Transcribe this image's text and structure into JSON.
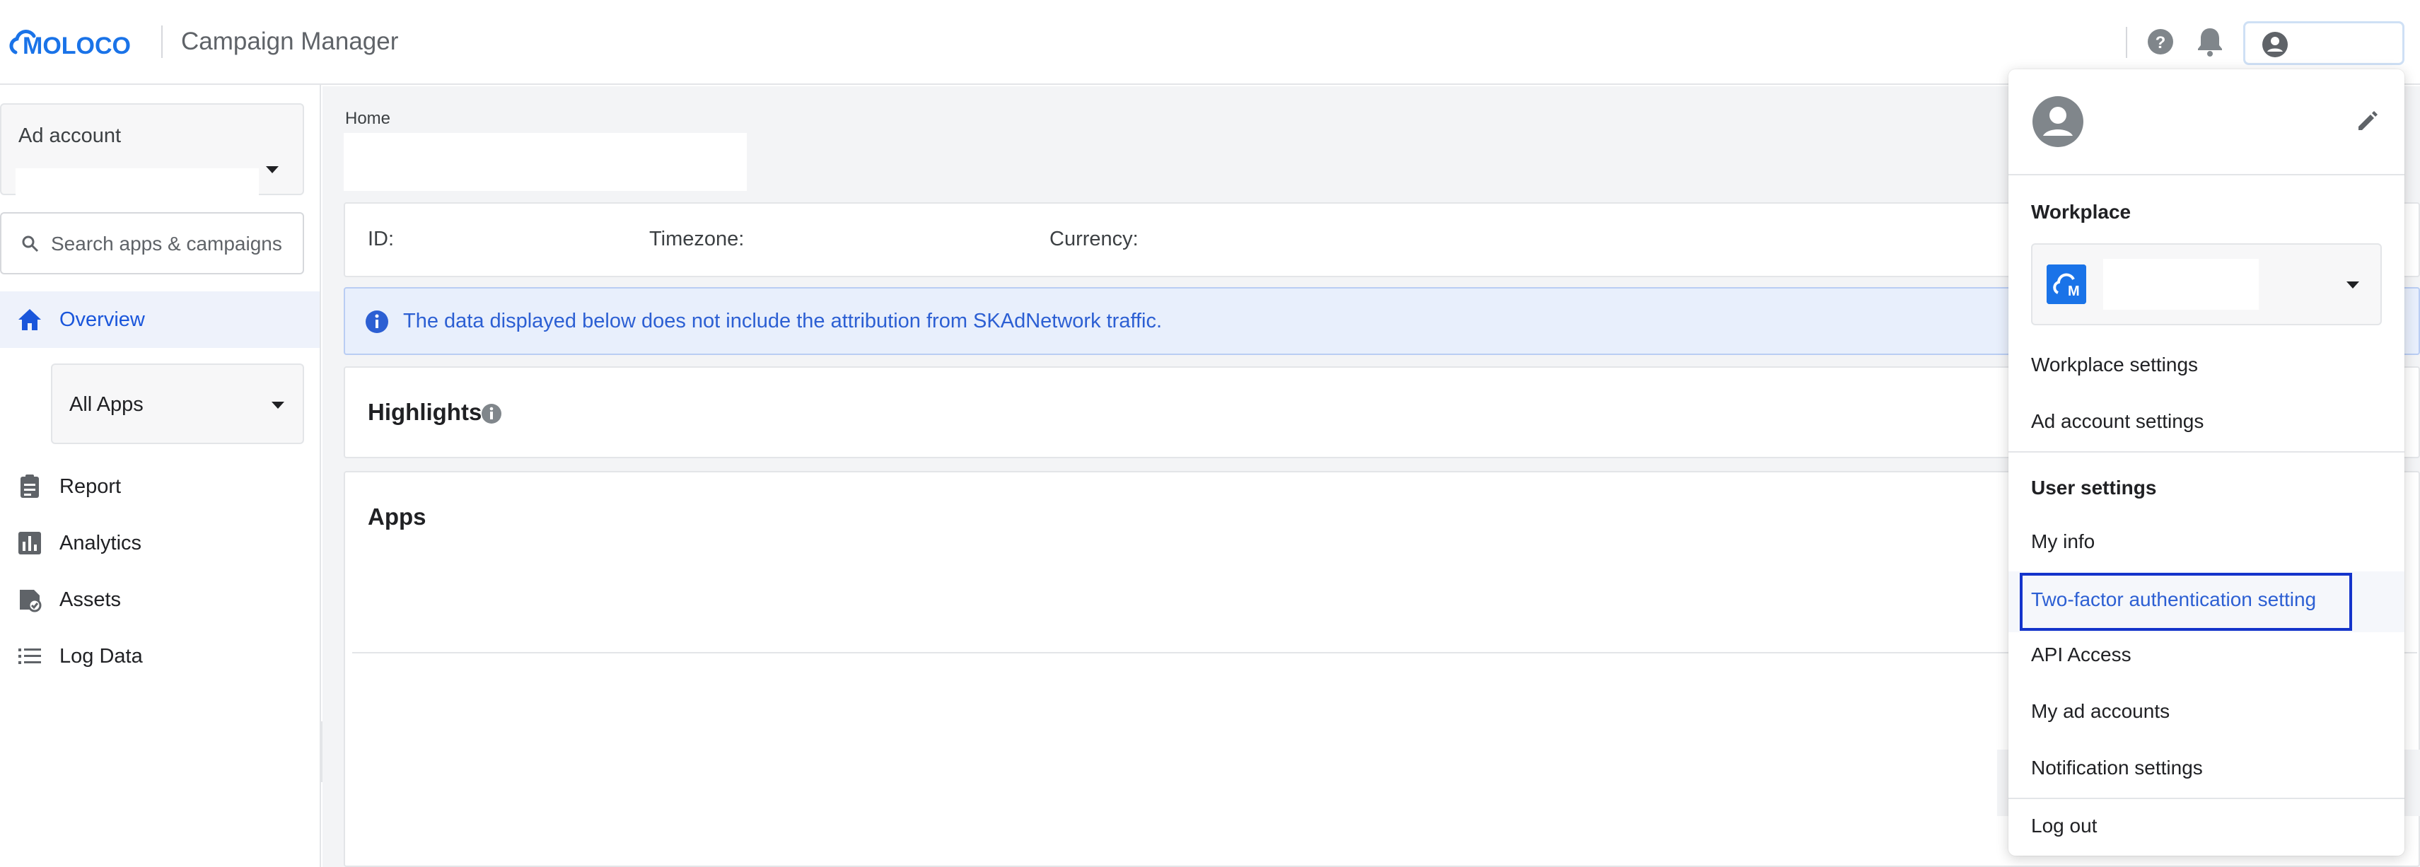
{
  "header": {
    "logo_text": "MOLOCO",
    "app_title": "Campaign Manager",
    "icons": [
      "help-icon",
      "bell-icon",
      "account-circle-icon"
    ]
  },
  "sidebar": {
    "ad_account": {
      "label": "Ad account",
      "value": ""
    },
    "search": {
      "placeholder": "Search apps & campaigns"
    },
    "items": [
      {
        "label": "Overview",
        "icon": "home-icon",
        "active": true
      },
      {
        "label": "Report",
        "icon": "clipboard-icon"
      },
      {
        "label": "Analytics",
        "icon": "bar-chart-icon"
      },
      {
        "label": "Assets",
        "icon": "assets-icon"
      },
      {
        "label": "Log Data",
        "icon": "list-icon"
      }
    ],
    "app_filter": "All Apps"
  },
  "main": {
    "breadcrumb": "Home",
    "info": {
      "id_label": "ID:",
      "timezone_label": "Timezone:",
      "currency_label": "Currency:"
    },
    "notice": "The data displayed below does not include the attribution from SKAdNetwork traffic.",
    "highlights_title": "Highlights",
    "apps_title": "Apps"
  },
  "menu": {
    "workplace_title": "Workplace",
    "workplace_items": [
      "Workplace settings",
      "Ad account settings"
    ],
    "user_settings_title": "User settings",
    "user_items": [
      "My info",
      "Two-factor authentication setting",
      "API Access",
      "My ad accounts",
      "Notification settings"
    ],
    "logout": "Log out"
  },
  "colors": {
    "accent": "#1a56db",
    "brand": "#1a73e8",
    "highlight_border": "#1434cb"
  }
}
